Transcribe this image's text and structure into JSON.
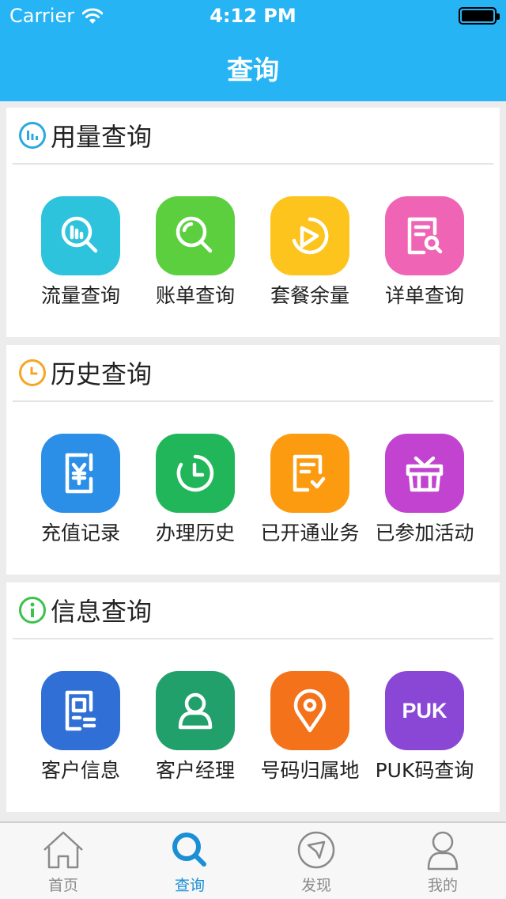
{
  "status_bar": {
    "carrier": "Carrier",
    "time": "4:12 PM"
  },
  "nav": {
    "title": "查询"
  },
  "colors": {
    "primary": "#27b4f4",
    "tab_active": "#1a8fd6",
    "usage_icon": "#29a9e0",
    "history_icon": "#f5a623",
    "info_icon": "#3cc24a"
  },
  "sections": [
    {
      "title": "用量查询",
      "icon": "bar-chart-icon",
      "items": [
        {
          "label": "流量查询",
          "icon": "chart-search-icon",
          "color": "#2ec3dc"
        },
        {
          "label": "账单查询",
          "icon": "search-icon",
          "color": "#5ccf3f"
        },
        {
          "label": "套餐余量",
          "icon": "pie-chart-icon",
          "color": "#fcc41c"
        },
        {
          "label": "详单查询",
          "icon": "document-search-icon",
          "color": "#ef64b4"
        }
      ]
    },
    {
      "title": "历史查询",
      "icon": "clock-icon",
      "items": [
        {
          "label": "充值记录",
          "icon": "yen-card-icon",
          "color": "#2b8fe8"
        },
        {
          "label": "办理历史",
          "icon": "history-clock-icon",
          "color": "#21b65a"
        },
        {
          "label": "已开通业务",
          "icon": "document-check-icon",
          "color": "#fc9b0f"
        },
        {
          "label": "已参加活动",
          "icon": "gift-basket-icon",
          "color": "#c143cf"
        }
      ]
    },
    {
      "title": "信息查询",
      "icon": "info-icon",
      "items": [
        {
          "label": "客户信息",
          "icon": "id-card-icon",
          "color": "#2f6fd6"
        },
        {
          "label": "客户经理",
          "icon": "person-icon",
          "color": "#21a06c"
        },
        {
          "label": "号码归属地",
          "icon": "location-pin-icon",
          "color": "#f3721a"
        },
        {
          "label": "PUK码查询",
          "icon": "puk-icon",
          "icon_text": "PUK",
          "color": "#8a47d6"
        }
      ]
    }
  ],
  "tabs": [
    {
      "label": "首页",
      "icon": "home-icon",
      "active": false
    },
    {
      "label": "查询",
      "icon": "search-icon",
      "active": true
    },
    {
      "label": "发现",
      "icon": "compass-icon",
      "active": false
    },
    {
      "label": "我的",
      "icon": "user-icon",
      "active": false
    }
  ]
}
